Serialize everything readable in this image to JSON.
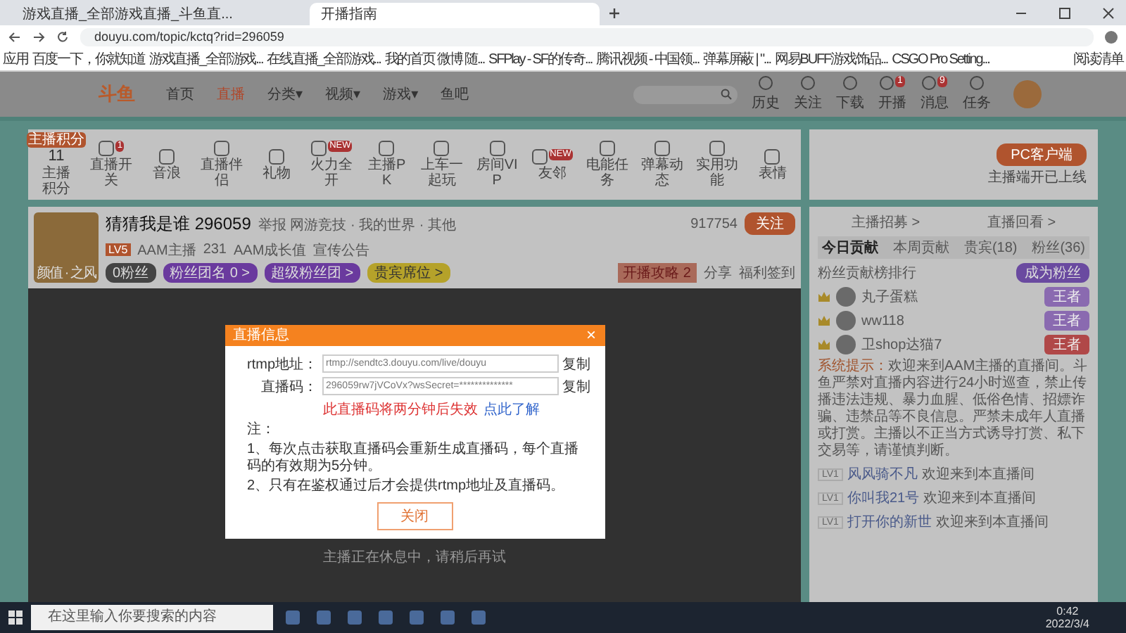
{
  "browser": {
    "tabs": [
      {
        "title": "游戏直播_全部游戏直播_斗鱼直...",
        "selected": false
      },
      {
        "title": "开播指南",
        "selected": true
      }
    ],
    "url": "douyu.com/topic/kctq?rid=296059",
    "bookmarks": [
      "应用",
      "百度一下，你就知道",
      "游戏直播_全部游戏...",
      "在线直播_全部游戏...",
      "我的首页 微博 随...",
      "SFPlay - SF的传奇...",
      "腾讯视频 - 中国领...",
      "弹幕屏蔽 | \"...",
      "网易BUFF游戏饰品...",
      "CSGO Pro Setting..."
    ],
    "reading_list": "阅读清单"
  },
  "site": {
    "logo": "斗鱼",
    "nav": [
      {
        "label": "首页",
        "selected": false
      },
      {
        "label": "直播",
        "selected": true
      },
      {
        "label": "分类▾",
        "selected": false
      },
      {
        "label": "视频▾",
        "selected": false
      },
      {
        "label": "游戏▾",
        "selected": false
      },
      {
        "label": "鱼吧",
        "selected": false
      }
    ],
    "header_icons": [
      {
        "label": "历史"
      },
      {
        "label": "关注"
      },
      {
        "label": "下载"
      },
      {
        "label": "开播",
        "badge": "1"
      },
      {
        "label": "消息",
        "badge": "9"
      },
      {
        "label": "任务"
      }
    ]
  },
  "toolbar": {
    "score_tag": "主播积分",
    "score": "11",
    "score_label": "主播积分",
    "tools": [
      {
        "label": "直播开关",
        "badge": "1"
      },
      {
        "label": "音浪"
      },
      {
        "label": "直播伴侣"
      },
      {
        "label": "礼物"
      },
      {
        "label": "火力全开",
        "badge": "NEW"
      },
      {
        "label": "主播PK"
      },
      {
        "label": "上车一起玩"
      },
      {
        "label": "房间VIP"
      },
      {
        "label": "友邻",
        "badge": "NEW"
      },
      {
        "label": "电能任务"
      },
      {
        "label": "弹幕动态"
      },
      {
        "label": "实用功能"
      },
      {
        "label": "表情"
      }
    ],
    "client_button": "PC客户端",
    "client_note": "主播端开已上线"
  },
  "room": {
    "title": "猜猜我是谁 296059",
    "meta": "举报   网游竞技 · 我的世界 · 其他",
    "level": "LV5",
    "stats": [
      "AAM主播",
      "231",
      "AAM成长值",
      "宣传公告"
    ],
    "badges": [
      "0粉丝",
      "粉丝团名 0 >",
      "超级粉丝团 >",
      "贵宾席位 >"
    ],
    "avatar_caption": "颜值 · 之风",
    "follow_count": "917754",
    "follow": "关注",
    "gift_banner": "开播攻略",
    "gift_count": "2",
    "share": "分享",
    "report": "福利签到"
  },
  "player": {
    "message": "主播正在休息中，请稍后再试"
  },
  "dialog": {
    "title": "直播信息",
    "close": "×",
    "rows": [
      {
        "label": "rtmp地址：",
        "value": "rtmp://sendtc3.douyu.com/live/douyu",
        "copy": "复制"
      },
      {
        "label": "直播码：",
        "value": "296059rw7jVCoVx?wsSecret=**************",
        "copy": "复制"
      }
    ],
    "warning": "此直播码将两分钟后失效",
    "link": "点此了解",
    "notes": [
      "注：",
      "1、每次点击获取直播码会重新生成直播码，每个直播码的有效期为5分钟。",
      "2、只有在鉴权通过后才会提供rtmp地址及直播码。"
    ],
    "button": "关闭"
  },
  "side": {
    "links": [
      "主播招募 >",
      "直播回看 >"
    ],
    "tabs": [
      {
        "label": "今日贡献",
        "selected": true
      },
      {
        "label": "本周贡献",
        "selected": false
      },
      {
        "label": "贵宾(18)",
        "selected": false
      },
      {
        "label": "粉丝(36)",
        "selected": false
      }
    ],
    "rank_title": "粉丝贡献榜排行",
    "join": "成为粉丝",
    "ranks": [
      {
        "name": "丸子蛋糕",
        "tag": "王者",
        "color": "#8a6ab0"
      },
      {
        "name": "ww118",
        "tag": "王者",
        "color": "#8a6ab0"
      },
      {
        "name": "卫shop达猫7",
        "tag": "王者",
        "color": "#b04848"
      }
    ],
    "notice_label": "系统提示：",
    "notice": "欢迎来到AAM主播的直播间。斗鱼严禁对直播内容进行24小时巡查，禁止传播违法违规、暴力血腥、低俗色情、招嫖诈骗、违禁品等不良信息。严禁未成年人直播或打赏。主播以不正当方式诱导打赏、私下交易等，请谨慎判断。",
    "chat": [
      {
        "level": "LV1",
        "name": "风风骑不凡",
        "text": "欢迎来到本直播间"
      },
      {
        "level": "LV1",
        "name": "你叫我21号",
        "text": "欢迎来到本直播间"
      },
      {
        "level": "LV1",
        "name": "打开你的新世",
        "text": "欢迎来到本直播间"
      }
    ]
  },
  "taskbar": {
    "search": "在这里输入你要搜索的内容",
    "time": "0:42",
    "date": "2022/3/4"
  }
}
